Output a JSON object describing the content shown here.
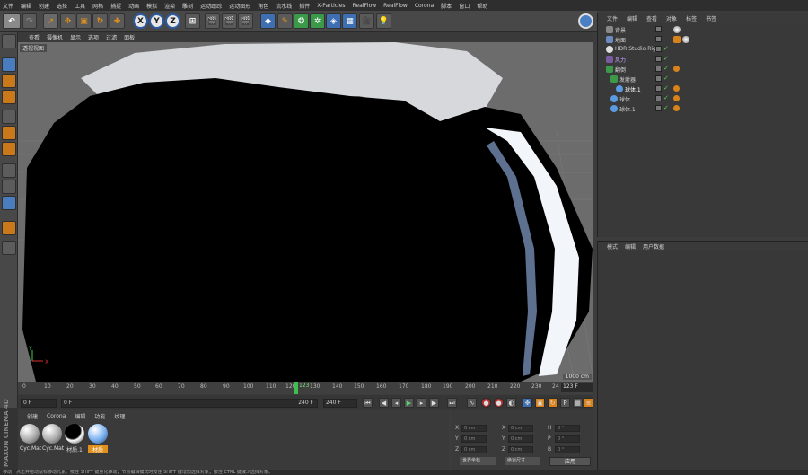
{
  "menu": [
    "文件",
    "编辑",
    "创建",
    "选择",
    "工具",
    "网格",
    "捕捉",
    "动画",
    "模拟",
    "渲染",
    "雕刻",
    "运动跟踪",
    "运动图形",
    "角色",
    "流水线",
    "插件",
    "X-Particles",
    "RealFlow",
    "RealFlow",
    "Corona",
    "脚本",
    "窗口",
    "帮助"
  ],
  "viewport": {
    "menu": [
      "查看",
      "摄像机",
      "显示",
      "选项",
      "过滤",
      "面板"
    ],
    "camera_label": "透视视图",
    "grid_spacing": "1000 cm",
    "axis_y": "Y",
    "axis_x": "X"
  },
  "timeline": {
    "ticks": [
      "0",
      "10",
      "20",
      "30",
      "40",
      "50",
      "60",
      "70",
      "80",
      "90",
      "100",
      "110",
      "120",
      "130",
      "140",
      "150",
      "160",
      "170",
      "180",
      "190",
      "200",
      "210",
      "220",
      "230",
      "24"
    ],
    "current_frame_label": "123",
    "current_frame": "123 F",
    "start_field": "0 F",
    "min_field": "0 F",
    "max_field": "240 F",
    "end_field": "240 F"
  },
  "materials": {
    "menu": [
      "创建",
      "Corona",
      "编辑",
      "功能",
      "纹理"
    ],
    "items": [
      {
        "name": "Cyc.Mat"
      },
      {
        "name": "Cyc.Mat"
      },
      {
        "name": "材质.1"
      },
      {
        "name": "材质"
      }
    ],
    "brand": "MAXON CINEMA 4D"
  },
  "coordinates": {
    "labels": [
      "X",
      "Y",
      "Z"
    ],
    "rot_labels": [
      "H",
      "P",
      "B"
    ],
    "field_value": "0 cm",
    "rot_value": "0 °",
    "mode_dropdown": "世界坐标",
    "scale_dropdown": "绝对尺寸",
    "apply": "应用"
  },
  "objects": {
    "menu": [
      "文件",
      "编辑",
      "查看",
      "对象",
      "标签",
      "书签"
    ],
    "rows": [
      {
        "name": "背景",
        "indent": 0
      },
      {
        "name": "地面",
        "indent": 0
      },
      {
        "name": "HDR Studio Rig",
        "indent": 0
      },
      {
        "name": "风力",
        "indent": 0
      },
      {
        "name": "翻倒",
        "indent": 0
      },
      {
        "name": "发射器",
        "indent": 1
      },
      {
        "name": "球体.1",
        "indent": 2
      },
      {
        "name": "球体",
        "indent": 1
      },
      {
        "name": "球体.1",
        "indent": 1
      }
    ]
  },
  "attributes": {
    "menu": [
      "模式",
      "编辑",
      "用户数据"
    ]
  },
  "status": "移动：点击并拖动鼠标移动元素。按住 SHIFT 键量化移动；节点编辑模式时按住 SHIFT 键增加选择对象；按住 CTRL 键减少选择对象。",
  "colors": {
    "accent_blue": "#3d6fb2",
    "accent_orange": "#d88a1a",
    "playhead_green": "#3fbf4f"
  }
}
